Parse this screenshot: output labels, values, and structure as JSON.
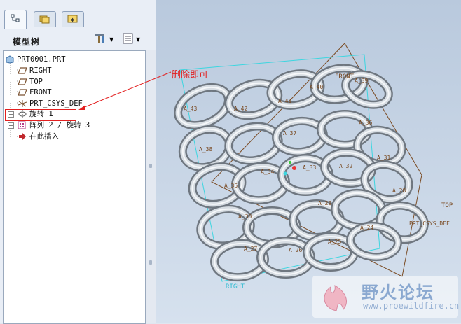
{
  "left_panel": {
    "tabs": [
      {
        "icon": "model-tree-icon"
      },
      {
        "icon": "folder-browser-icon"
      },
      {
        "icon": "favorites-icon"
      }
    ],
    "title": "模型树",
    "settings_icon": "tree-settings-icon",
    "show_icon": "tree-columns-icon"
  },
  "tree": {
    "items": [
      {
        "label": "PRT0001.PRT",
        "icon": "part-icon"
      },
      {
        "label": "RIGHT",
        "icon": "datum-plane-icon"
      },
      {
        "label": "TOP",
        "icon": "datum-plane-icon"
      },
      {
        "label": "FRONT",
        "icon": "datum-plane-icon"
      },
      {
        "label": "PRT_CSYS_DEF",
        "icon": "csys-icon"
      },
      {
        "label": "旋转 1",
        "icon": "revolve-icon"
      },
      {
        "label": "阵列 2 / 旋转 3",
        "icon": "pattern-icon"
      },
      {
        "label": "在此插入",
        "icon": "insert-here-icon"
      }
    ]
  },
  "annotation": {
    "text": "删除即可",
    "color": "#e31f1f"
  },
  "viewport": {
    "datum_labels": [
      "FRONT",
      "TOP",
      "RIGHT",
      "PRT_CSYS_DEF"
    ],
    "axis_labels": [
      "A_43",
      "A_42",
      "A_41",
      "A_40",
      "A_39",
      "A_38",
      "A_37",
      "A_36",
      "A_35",
      "A_34",
      "A_33",
      "A_32",
      "A_31",
      "A_30",
      "A_29",
      "A_28",
      "A_27",
      "A_26",
      "A_25",
      "A_24"
    ]
  },
  "watermark": {
    "name": "野火论坛",
    "url": "www.proewildfire.cn"
  }
}
